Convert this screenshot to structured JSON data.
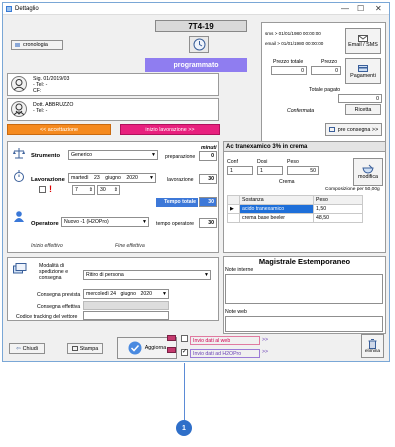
{
  "window": {
    "title": "Dettaglio",
    "minimize": "—",
    "maximize": "☐",
    "close": "✕"
  },
  "header": {
    "code": "7T4-19",
    "status": "programmato",
    "cronologia": "cronologia"
  },
  "contact": {
    "sms": "sms > 01/01/1980 00:00:00",
    "email": "email > 01/01/1980 00:00:00",
    "email_sms_btn": "Email / SMS",
    "prezzo_totale_label": "Prezzo totale",
    "prezzo_label": "Prezzo",
    "prezzo_totale": "0",
    "prezzo": "0",
    "pagamenti_btn": "Pagamenti",
    "totale_pagato_label": "Totale pagato",
    "totale_pagato": "0",
    "confermata": "Confermata",
    "ricetta_btn": "Ricetta"
  },
  "patient": {
    "line1": "Sig. 01/2019/03",
    "line2": "- Tel:  -",
    "line3": "CF:"
  },
  "doctor": {
    "line1": "Dott. ABBRUZZO",
    "line2": "- Tel:  -"
  },
  "actions": {
    "accettazione": "<< accettazione",
    "inizio": "inizio lavorazione >>",
    "pre_consegna": "pre consegna >>"
  },
  "strumento": {
    "label": "Strumento",
    "value": "Generico",
    "minuti": "minuti",
    "preparazione_label": "preparazione",
    "preparazione": "0"
  },
  "lavorazione": {
    "label": "Lavorazione",
    "day": "martedì",
    "date": "23",
    "month": "giugno",
    "year": "2020",
    "hour": "7",
    "minute": "30",
    "lav_label": "lavorazione",
    "lav_value": "30",
    "tempo_totale_label": "Tempo totale",
    "tempo_totale": "30"
  },
  "operatore": {
    "label": "Operatore",
    "value": "Nuovo -1 (H2OPro)",
    "tempo_label": "tempo operatore",
    "tempo": "30"
  },
  "effettivo": {
    "inizio": "Inizio effettivo",
    "fine": "Fine effettiva"
  },
  "spedizione": {
    "modalita_label": "Modalità di spedizione e consegna",
    "modalita": "Ritiro di persona",
    "prevista_label": "Consegna prevista",
    "prevista_day": "mercoledì 24",
    "prevista_month": "giugno",
    "prevista_year": "2020",
    "effettiva_label": "Consegna effettiva",
    "tracking_label": "Codice tracking del vettore"
  },
  "recipe": {
    "title": "Ac tranexamico 3% in crema",
    "conf_label": "Conf",
    "dosi_label": "Dosi",
    "peso_label": "Peso",
    "conf": "1",
    "dosi": "1",
    "peso": "50",
    "form": "Crema",
    "modifica": "modifica",
    "composizione": "Composizione per 50,00g",
    "table_headers": [
      "",
      "Sostanza",
      "Peso"
    ],
    "rows": [
      {
        "marker": "▶",
        "sostanza": "acido tranexamico",
        "peso": "1,50"
      },
      {
        "marker": "",
        "sostanza": "crema base beeler",
        "peso": "48,50"
      }
    ]
  },
  "magistrale": {
    "title": "Magistrale Estemporaneo",
    "note_interne": "Note interne",
    "note_web": "Note web"
  },
  "bottom": {
    "chiudi": "Chiudi",
    "stampa": "Stampa",
    "aggiorna": "Aggiorna",
    "invio_web": "Invio dati al web",
    "invio_h2o": "Invio dati ad H2OPro",
    "elimina": "elimina"
  },
  "callout": {
    "number": "1"
  }
}
